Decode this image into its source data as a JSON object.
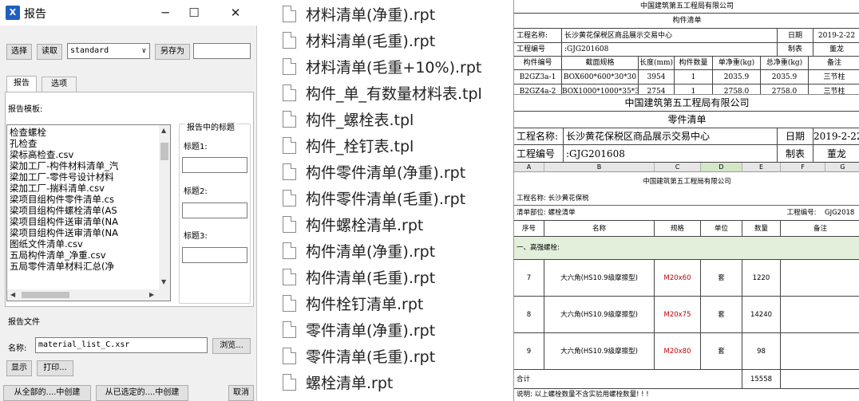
{
  "dialog": {
    "title": "报告",
    "buttons": {
      "select": "选择",
      "read": "读取",
      "save_as": "另存为",
      "browse": "浏览...",
      "display": "显示",
      "print": "打印...",
      "create_all": "从全部的....中创建",
      "create_selected": "从已选定的....中创建",
      "cancel": "取消"
    },
    "standard_select": "standard",
    "tabs": [
      "报告",
      "选项"
    ],
    "template_label": "报告模板:",
    "title_group_label": "报告中的标题",
    "title_labels": [
      "标题1:",
      "标题2:",
      "标题3:"
    ],
    "templates": [
      "检查螺栓",
      "孔检查",
      "梁标高检查.csv",
      "梁加工厂-构件材料清单_汽",
      "梁加工厂-零件号设计材料",
      "梁加工厂-揣料清单.csv",
      "梁项目组构件零件清单.cs",
      "梁项目组构件螺栓清单(AS",
      "梁项目组构件送审清单(NA",
      "梁项目组构件送审清单(NA",
      "图纸文件清单.csv",
      "五局构件清单_净重.csv",
      "五局零件清单材料汇总(净"
    ],
    "report_file_label": "报告文件",
    "name_label": "名称:",
    "name_value": "material_list_C.xsr"
  },
  "files": [
    "材料清单(净重).rpt",
    "材料清单(毛重).rpt",
    "材料清单(毛重+10%).rpt",
    "构件_单_有数量材料表.tpl",
    "构件_螺栓表.tpl",
    "构件_栓钉表.tpl",
    "构件零件清单(净重).rpt",
    "构件零件清单(毛重).rpt",
    "构件螺栓清单.rpt",
    "构件清单(净重).rpt",
    "构件清单(毛重).rpt",
    "构件栓钉清单.rpt",
    "零件清单(净重).rpt",
    "零件清单(毛重).rpt",
    "螺栓清单.rpt"
  ],
  "sheet1": {
    "company": "中国建筑第五工程局有限公司",
    "title": "构件清单",
    "project_label": "工程名称:",
    "project": "长沙黄花保税区商品展示交易中心",
    "date_label": "日期",
    "date": "2019-2-22",
    "number_label": "工程编号",
    "number": ":GJG201608",
    "maker_label": "制表",
    "maker": "董龙",
    "headers": [
      "构件编号",
      "截面规格",
      "长度(mm)",
      "构件数量",
      "单净重(kg)",
      "总净重(kg)",
      "备注"
    ],
    "rows": [
      [
        "B2GZ3a-1",
        "BOX600*600*30*30",
        "3954",
        "1",
        "2035.9",
        "2035.9",
        "三节柱"
      ],
      [
        "B2GZ4a-2",
        "BOX1000*1000*35*35",
        "2754",
        "1",
        "2758.0",
        "2758.0",
        "三节柱"
      ]
    ]
  },
  "sheet2": {
    "company": "中国建筑第五工程局有限公司",
    "title": "零件清单",
    "project_label": "工程名称:",
    "project": "长沙黄花保税区商品展示交易中心",
    "date_label": "日期",
    "date": "2019-2-22",
    "number_label": "工程编号",
    "number": ":GJG201608",
    "maker_label": "制表",
    "maker": "董龙"
  },
  "sheet3": {
    "columns": [
      "A",
      "B",
      "C",
      "D",
      "E",
      "F",
      "G"
    ],
    "company": "中国建筑第五工程局有限公司",
    "project": "工程名称: 长沙黄花保税",
    "part": "清单部位: 螺栓清单",
    "number_label": "工程编号:",
    "number": "GJG2018",
    "headers": [
      "序号",
      "名称",
      "规格",
      "单位",
      "数量",
      "备注"
    ],
    "section": "一、高强螺栓:",
    "rows": [
      [
        "7",
        "大六角(HS10.9级摩擦型)",
        "M20x60",
        "套",
        "1220",
        ""
      ],
      [
        "8",
        "大六角(HS10.9级摩擦型)",
        "M20x75",
        "套",
        "14240",
        ""
      ],
      [
        "9",
        "大六角(HS10.9级摩擦型)",
        "M20x80",
        "套",
        "98",
        ""
      ]
    ],
    "total_label": "合计",
    "total": "15558",
    "note": "说明: 以上螺栓数量不含实验用螺栓数量! ! !"
  }
}
